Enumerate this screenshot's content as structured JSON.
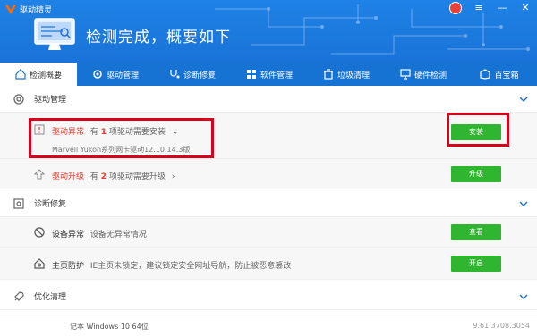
{
  "app": {
    "title": "驱动精灵"
  },
  "hero": {
    "text": "检测完成，概要如下"
  },
  "tabs": [
    {
      "label": "检测概要",
      "icon": "home-icon"
    },
    {
      "label": "驱动管理",
      "icon": "gear-icon"
    },
    {
      "label": "诊断修复",
      "icon": "stethoscope-icon"
    },
    {
      "label": "软件管理",
      "icon": "grid-icon"
    },
    {
      "label": "垃圾清理",
      "icon": "trash-icon"
    },
    {
      "label": "硬件检测",
      "icon": "monitor-icon"
    },
    {
      "label": "百宝箱",
      "icon": "box-icon"
    }
  ],
  "sections": {
    "driver": {
      "title": "驱动管理",
      "abnormal": {
        "status": "驱动异常",
        "prefix": "有",
        "count": "1",
        "suffix": "项驱动需要安装",
        "detail": "Marvell Yukon系列网卡驱动12.10.14.3版",
        "button": "安装"
      },
      "upgrade": {
        "status": "驱动升级",
        "prefix": "有",
        "count": "2",
        "suffix": "项驱动需要升级",
        "button": "升级"
      }
    },
    "diagnose": {
      "title": "诊断修复",
      "device": {
        "status": "设备异常",
        "text": "设备无异常情况",
        "button": "查看"
      },
      "homepage": {
        "status": "主页防护",
        "text": "IE主页未锁定，建议锁定安全网址导航，防止被恶意篡改",
        "button": "开启"
      }
    },
    "optimize": {
      "title": "优化清理"
    }
  },
  "footer": {
    "left": "记本    Windows 10 64位",
    "version": "9.61.3708.3054"
  },
  "colors": {
    "header": "#1f82e6",
    "tabbar": "#1673d4",
    "button": "#2fb52f",
    "highlight": "#d9001b"
  }
}
